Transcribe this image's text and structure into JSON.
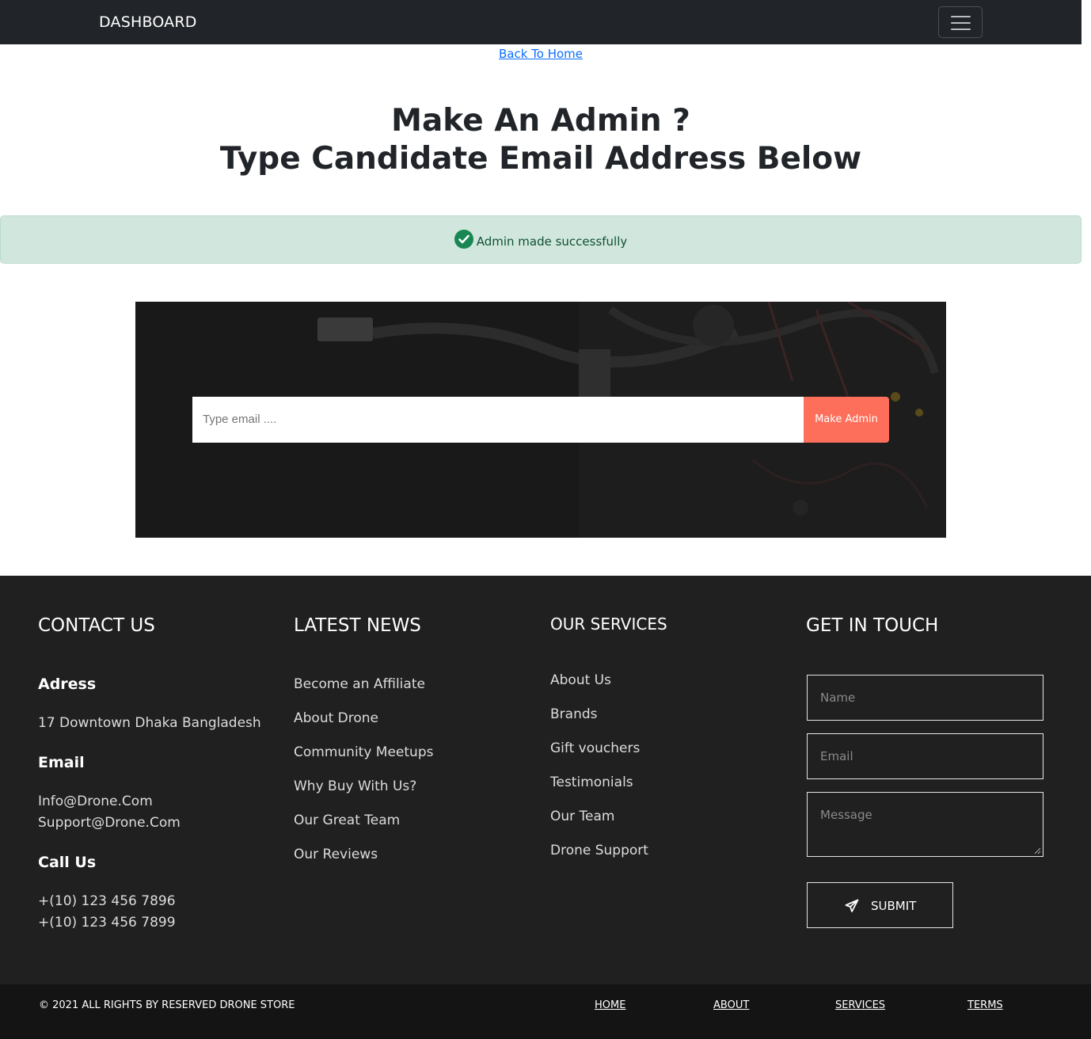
{
  "navbar": {
    "brand": "DASHBOARD",
    "menu_icon": "hamburger-menu-icon"
  },
  "back_link": "Back To Home",
  "heading": {
    "line1": "Make An Admin ?",
    "line2": "Type Candidate Email Address Below"
  },
  "alert": {
    "icon": "check-circle-icon",
    "message": "Admin made successfully",
    "color": "#0f5132"
  },
  "admin_form": {
    "email_placeholder": "Type email ....",
    "email_value": "",
    "button_label": "Make Admin",
    "button_color": "#fd6f5a"
  },
  "footer": {
    "contact": {
      "title": "CONTACT US",
      "address_heading": "Adress",
      "address": "17 Downtown Dhaka Bangladesh",
      "email_heading": "Email",
      "emails": [
        "Info@Drone.Com",
        "Support@Drone.Com"
      ],
      "call_heading": "Call Us",
      "phones": [
        "+(10) 123 456 7896",
        "+(10) 123 456 7899"
      ]
    },
    "news": {
      "title": "LATEST NEWS",
      "links": [
        "Become an Affiliate",
        "About Drone",
        "Community Meetups",
        "Why Buy With Us?",
        "Our Great Team",
        "Our Reviews"
      ]
    },
    "services": {
      "title": "OUR SERVICES",
      "links": [
        "About Us",
        "Brands",
        "Gift vouchers",
        "Testimonials",
        "Our Team",
        "Drone Support"
      ]
    },
    "touch": {
      "title": "GET IN TOUCH",
      "name_placeholder": "Name",
      "email_placeholder": "Email",
      "message_placeholder": "Message",
      "submit_label": "SUBMIT",
      "submit_icon": "paper-plane-icon"
    }
  },
  "bottom_bar": {
    "copyright": "© 2021 ALL RIGHTS BY RESERVED DRONE STORE",
    "links": [
      "HOME",
      "ABOUT",
      "SERVICES",
      "TERMS"
    ]
  }
}
